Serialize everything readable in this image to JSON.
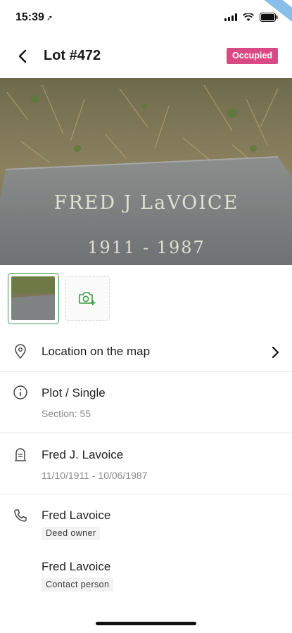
{
  "status": {
    "time": "15:39",
    "location_glyph": "➚"
  },
  "header": {
    "title": "Lot #472",
    "badge": "Occupied",
    "badge_color": "#d94a84"
  },
  "photo": {
    "engraving_name": "FRED J LaVOICE",
    "engraving_years": "1911 - 1987"
  },
  "thumbnails": {
    "add_icon": "camera-plus-icon"
  },
  "location": {
    "label": "Location on the map"
  },
  "plot": {
    "title": "Plot / Single",
    "section": "Section: 55"
  },
  "deceased": {
    "name": "Fred J. Lavoice",
    "dates": "11/10/1911 - 10/06/1987"
  },
  "contacts": [
    {
      "name": "Fred Lavoice",
      "role": "Deed owner"
    },
    {
      "name": "Fred Lavoice",
      "role": "Contact person"
    }
  ],
  "accent": "#3f9a46"
}
